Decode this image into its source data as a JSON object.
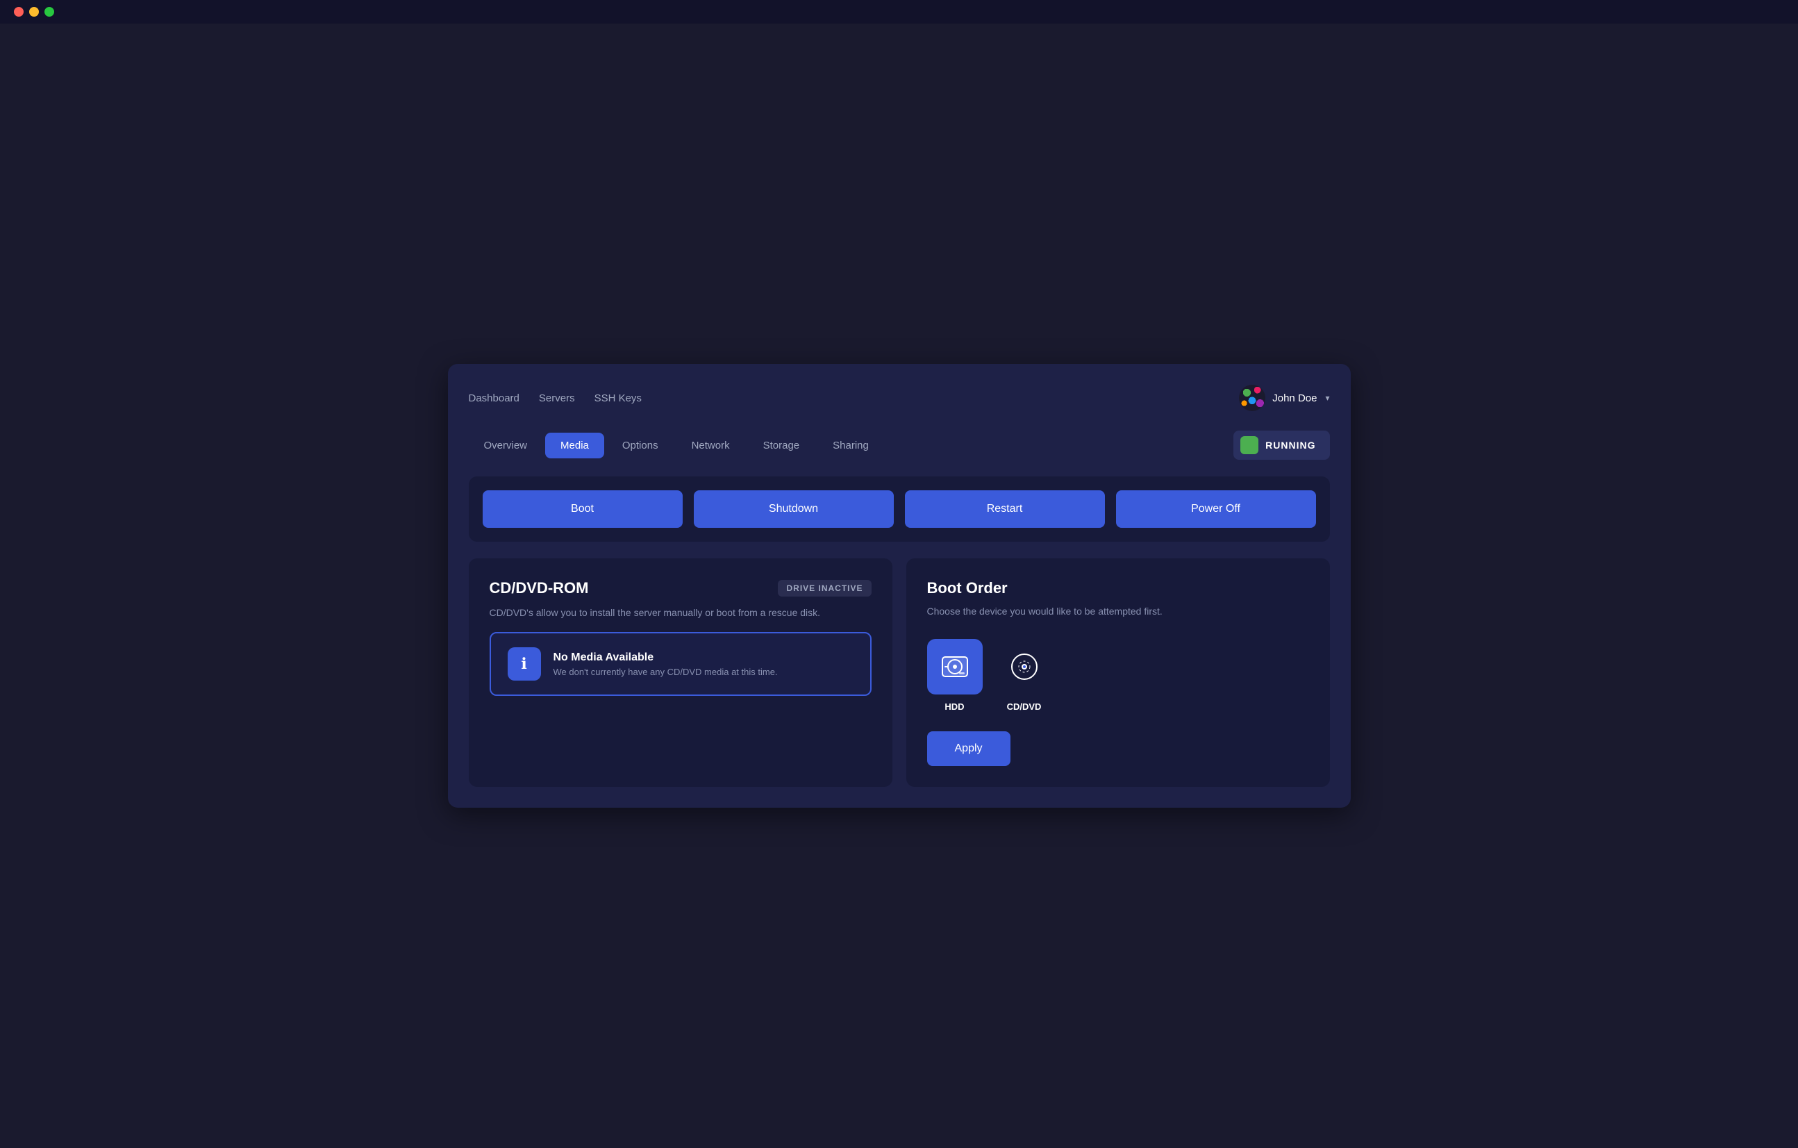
{
  "titleBar": {
    "trafficLights": [
      "red",
      "yellow",
      "green"
    ]
  },
  "topNav": {
    "links": [
      {
        "label": "Dashboard",
        "id": "dashboard"
      },
      {
        "label": "Servers",
        "id": "servers"
      },
      {
        "label": "SSH Keys",
        "id": "ssh-keys"
      }
    ],
    "user": {
      "name": "John Doe",
      "dropdownArrow": "▾"
    }
  },
  "tabs": [
    {
      "label": "Overview",
      "id": "overview",
      "active": false
    },
    {
      "label": "Media",
      "id": "media",
      "active": true
    },
    {
      "label": "Options",
      "id": "options",
      "active": false
    },
    {
      "label": "Network",
      "id": "network",
      "active": false
    },
    {
      "label": "Storage",
      "id": "storage",
      "active": false
    },
    {
      "label": "Sharing",
      "id": "sharing",
      "active": false
    }
  ],
  "statusBadge": {
    "text": "RUNNING",
    "color": "#4caf50"
  },
  "actionButtons": [
    {
      "label": "Boot",
      "id": "boot"
    },
    {
      "label": "Shutdown",
      "id": "shutdown"
    },
    {
      "label": "Restart",
      "id": "restart"
    },
    {
      "label": "Power Off",
      "id": "power-off"
    }
  ],
  "cdDvdPanel": {
    "title": "CD/DVD-ROM",
    "driveBadge": "DRIVE INACTIVE",
    "description": "CD/DVD's allow you to install the server manually or boot from a rescue disk.",
    "mediaBox": {
      "title": "No Media Available",
      "subtitle": "We don't currently have any CD/DVD media at this time.",
      "icon": "ℹ"
    }
  },
  "bootOrderPanel": {
    "title": "Boot Order",
    "description": "Choose the device you would like to be attempted first.",
    "devices": [
      {
        "label": "HDD",
        "id": "hdd",
        "active": true
      },
      {
        "label": "CD/DVD",
        "id": "cddvd",
        "active": false
      }
    ],
    "applyButton": "Apply"
  }
}
